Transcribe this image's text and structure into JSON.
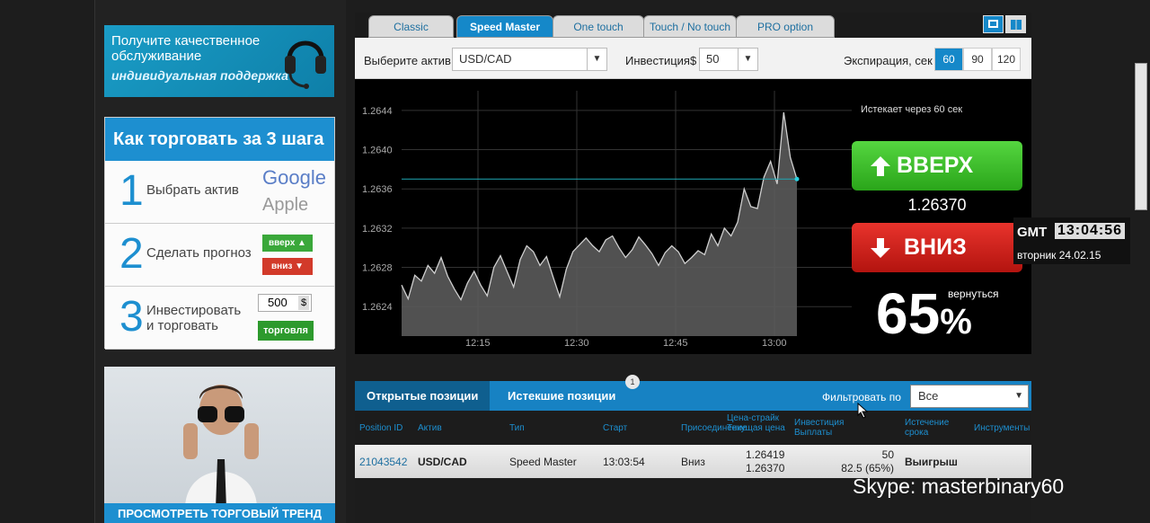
{
  "promo": {
    "support_line1": "Получите качественное обслуживание",
    "support_line2": "индивидуальная поддержка",
    "steps_title": "Как торговать за 3 шага",
    "step1_num": "1",
    "step1_text": "Выбрать актив",
    "step1_brand1": "Google",
    "step1_brand2": "Apple",
    "step2_num": "2",
    "step2_text": "Сделать прогноз",
    "step2_up": "вверх ▲",
    "step2_down": "вниз ▼",
    "step3_num": "3",
    "step3_text1": "Инвестировать",
    "step3_text2": "и торговать",
    "step3_amount": "500",
    "step3_currency": "$",
    "step3_button": "торговля",
    "trend_caption": "ПРОСМОТРЕТЬ ТОРГОВЫЙ ТРЕНД"
  },
  "tabs": [
    "Classic",
    "Speed Master",
    "One touch",
    "Touch / No touch",
    "PRO option"
  ],
  "active_tab": "Speed Master",
  "toolbar": {
    "asset_label": "Выберите актив",
    "asset_value": "USD/CAD",
    "invest_label": "Инвестиция$",
    "invest_value": "50",
    "expiry_label": "Экспирация, сек",
    "expiry_options": [
      "60",
      "90",
      "120"
    ],
    "expiry_selected": "60"
  },
  "trade": {
    "expires_text": "Истекает через 60 сек",
    "up_label": "ВВЕРХ",
    "down_label": "ВНИЗ",
    "current_price": "1.26370",
    "payout": "65",
    "payout_unit": "%",
    "return_label": "вернуться"
  },
  "chart_data": {
    "type": "area",
    "y_ticks": [
      "1.2644",
      "1.2640",
      "1.2636",
      "1.2632",
      "1.2628",
      "1.2624"
    ],
    "x_ticks": [
      "12:15",
      "12:30",
      "12:45",
      "13:00"
    ],
    "ylim": [
      1.2621,
      1.2646
    ],
    "strike_level": 1.2637,
    "series": [
      {
        "values": [
          1.26262,
          1.26248,
          1.26272,
          1.26266,
          1.26282,
          1.26274,
          1.2629,
          1.26271,
          1.26258,
          1.26247,
          1.26264,
          1.26276,
          1.26262,
          1.26251,
          1.2628,
          1.26292,
          1.26276,
          1.2626,
          1.26288,
          1.26302,
          1.26296,
          1.26282,
          1.26291,
          1.2627,
          1.2625,
          1.26278,
          1.26296,
          1.26303,
          1.2631,
          1.26302,
          1.26296,
          1.26308,
          1.26312,
          1.263,
          1.2629,
          1.26298,
          1.26311,
          1.26303,
          1.26294,
          1.26282,
          1.26295,
          1.26302,
          1.26296,
          1.26284,
          1.2629,
          1.26297,
          1.26293,
          1.26314,
          1.26302,
          1.2632,
          1.26312,
          1.26326,
          1.2636,
          1.26342,
          1.2634,
          1.26372,
          1.26388,
          1.26365,
          1.26438,
          1.26392,
          1.2637
        ]
      }
    ]
  },
  "positions": {
    "tab_open": "Открытые позиции",
    "tab_expired": "Истекшие позиции",
    "badge": "1",
    "filter_label": "Фильтровать по",
    "filter_value": "Все",
    "headers": {
      "id": "Position ID",
      "asset": "Актив",
      "type": "Тип",
      "start": "Старт",
      "direction": "Присоединение",
      "price1": "Цена-страйк",
      "price2": "Текущая цена",
      "invest1": "Инвестиция",
      "invest2": "Выплаты",
      "expiry1": "Истечение",
      "expiry2": "срока",
      "instrument": "Инструменты"
    },
    "row": {
      "id": "21043542",
      "asset": "USD/CAD",
      "type": "Speed Master",
      "start": "13:03:54",
      "direction": "Вниз",
      "strike": "1.26419",
      "current": "1.26370",
      "invest": "50",
      "payout": "82.5 (65%)",
      "result": "Выигрыш"
    }
  },
  "clock": {
    "zone": "GMT",
    "time": "13:04:56",
    "date": "вторник 24.02.15"
  },
  "overlay": {
    "skype": "Skype: masterbinary60"
  }
}
